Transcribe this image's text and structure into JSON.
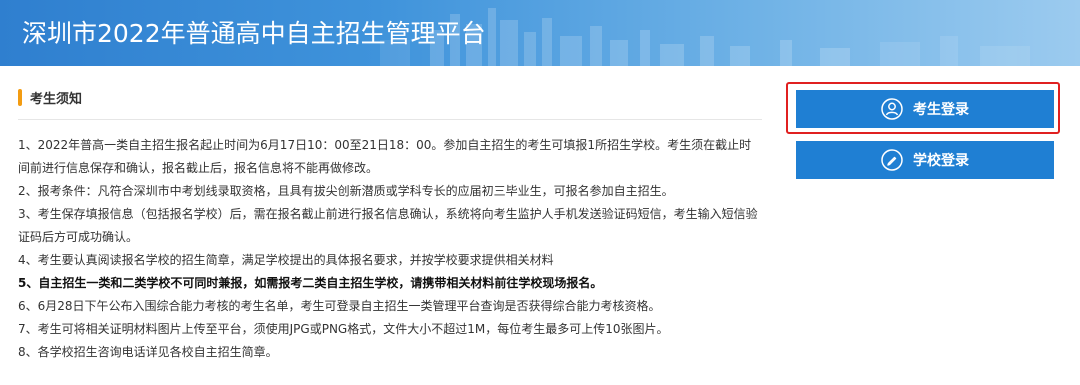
{
  "header": {
    "title": "深圳市2022年普通高中自主招生管理平台"
  },
  "notice": {
    "title": "考生须知",
    "items": [
      {
        "text": "1、2022年普高一类自主招生报名起止时间为6月17日10：00至21日18：00。参加自主招生的考生可填报1所招生学校。考生须在截止时间前进行信息保存和确认，报名截止后，报名信息将不能再做修改。",
        "bold": false
      },
      {
        "text": "2、报考条件：凡符合深圳市中考划线录取资格，且具有拔尖创新潜质或学科专长的应届初三毕业生，可报名参加自主招生。",
        "bold": false
      },
      {
        "text": "3、考生保存填报信息（包括报名学校）后，需在报名截止前进行报名信息确认，系统将向考生监护人手机发送验证码短信，考生输入短信验证码后方可成功确认。",
        "bold": false
      },
      {
        "text": "4、考生要认真阅读报名学校的招生简章，满足学校提出的具体报名要求，并按学校要求提供相关材料",
        "bold": false
      },
      {
        "text": "5、自主招生一类和二类学校不可同时兼报，如需报考二类自主招生学校，请携带相关材料前往学校现场报名。",
        "bold": true
      },
      {
        "text": "6、6月28日下午公布入围综合能力考核的考生名单，考生可登录自主招生一类管理平台查询是否获得综合能力考核资格。",
        "bold": false
      },
      {
        "text": "7、考生可将相关证明材料图片上传至平台，须使用JPG或PNG格式，文件大小不超过1M，每位考生最多可上传10张图片。",
        "bold": false
      },
      {
        "text": "8、各学校招生咨询电话详见各校自主招生简章。",
        "bold": false
      }
    ]
  },
  "login": {
    "student_label": "考生登录",
    "school_label": "学校登录",
    "student_icon": "user-icon",
    "school_icon": "pencil-icon"
  },
  "colors": {
    "button_blue": "#1f7fd3",
    "accent_orange": "#f39c12",
    "highlight_red": "#e02020"
  }
}
